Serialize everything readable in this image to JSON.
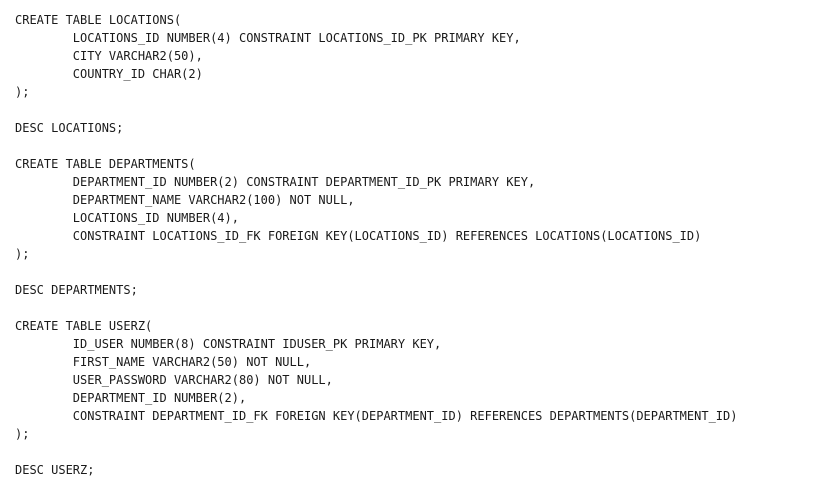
{
  "lines": [
    "CREATE TABLE LOCATIONS(",
    "        LOCATIONS_ID NUMBER(4) CONSTRAINT LOCATIONS_ID_PK PRIMARY KEY,",
    "        CITY VARCHAR2(50),",
    "        COUNTRY_ID CHAR(2)",
    ");",
    "",
    "DESC LOCATIONS;",
    "",
    "CREATE TABLE DEPARTMENTS(",
    "        DEPARTMENT_ID NUMBER(2) CONSTRAINT DEPARTMENT_ID_PK PRIMARY KEY,",
    "        DEPARTMENT_NAME VARCHAR2(100) NOT NULL,",
    "        LOCATIONS_ID NUMBER(4),",
    "        CONSTRAINT LOCATIONS_ID_FK FOREIGN KEY(LOCATIONS_ID) REFERENCES LOCATIONS(LOCATIONS_ID)",
    ");",
    "",
    "DESC DEPARTMENTS;",
    "",
    "CREATE TABLE USERZ(",
    "        ID_USER NUMBER(8) CONSTRAINT IDUSER_PK PRIMARY KEY,",
    "        FIRST_NAME VARCHAR2(50) NOT NULL,",
    "        USER_PASSWORD VARCHAR2(80) NOT NULL,",
    "        DEPARTMENT_ID NUMBER(2),",
    "        CONSTRAINT DEPARTMENT_ID_FK FOREIGN KEY(DEPARTMENT_ID) REFERENCES DEPARTMENTS(DEPARTMENT_ID)",
    ");",
    "",
    "DESC USERZ;"
  ]
}
